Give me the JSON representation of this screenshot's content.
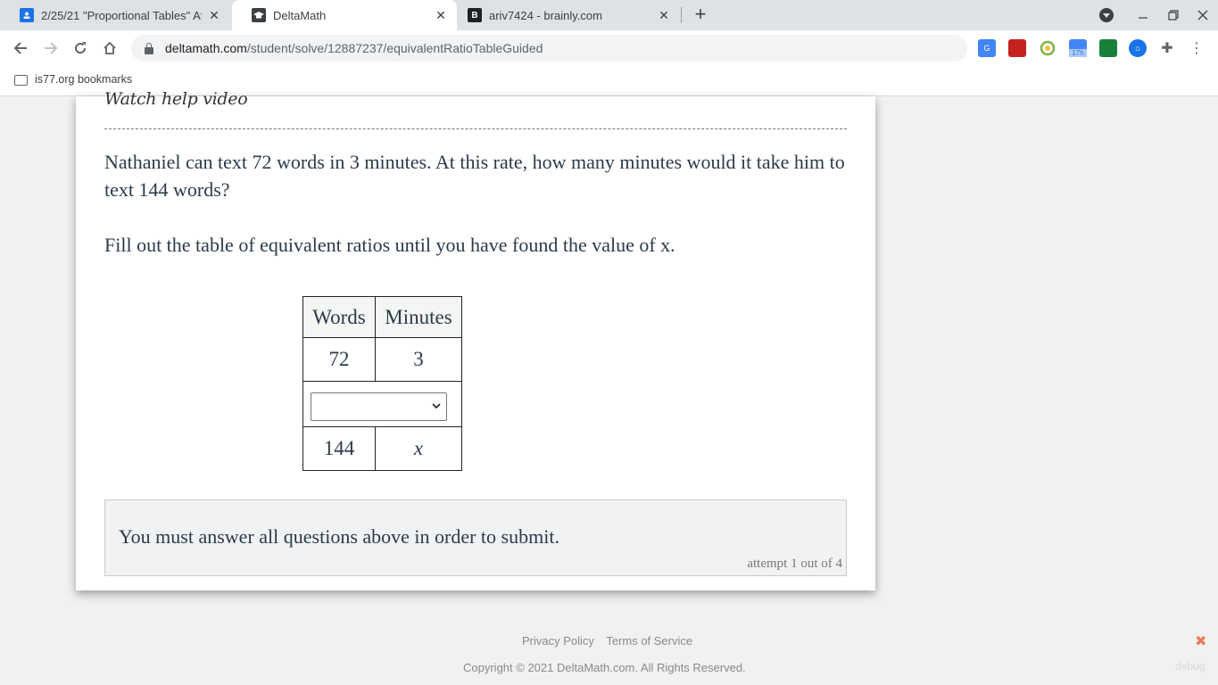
{
  "browser": {
    "tabs": [
      {
        "title": "2/25/21 \"Proportional Tables\" At",
        "icon": "classroom-icon",
        "color": "#1a73e8",
        "active": false
      },
      {
        "title": "DeltaMath",
        "icon": "graduation-cap-icon",
        "color": "#3c4043",
        "active": true
      },
      {
        "title": "ariv7424 - brainly.com",
        "icon": "brainly-icon",
        "color": "#202124",
        "active": false
      }
    ],
    "new_tab": "+",
    "url_host": "deltamath.com",
    "url_path": "/student/solve/12887237/equivalentRatioTableGuided",
    "extensions": [
      "translate-icon",
      "bookmark-red-icon",
      "timer-icon",
      "calendar-icon",
      "cast-icon",
      "bank-icon",
      "puzzle-icon"
    ],
    "extension_badge": "17h",
    "bookmarks": [
      {
        "label": "is77.org bookmarks"
      }
    ]
  },
  "page": {
    "help_link": "Watch help video",
    "problem": "Nathaniel can text 72 words in 3 minutes. At this rate, how many minutes would it take him to text 144 words?",
    "instruction": "Fill out the table of equivalent ratios until you have found the value of x.",
    "table": {
      "headers": [
        "Words",
        "Minutes"
      ],
      "row1": [
        "72",
        "3"
      ],
      "select_value": "",
      "row3": [
        "144",
        "x"
      ]
    },
    "submit_message": "You must answer all questions above in order to submit.",
    "attempt": "attempt 1 out of 4"
  },
  "footer": {
    "privacy": "Privacy Policy",
    "terms": "Terms of Service",
    "copyright": "Copyright © 2021 DeltaMath.com. All Rights Reserved.",
    "debug_close": "✖",
    "debug": "debug"
  }
}
